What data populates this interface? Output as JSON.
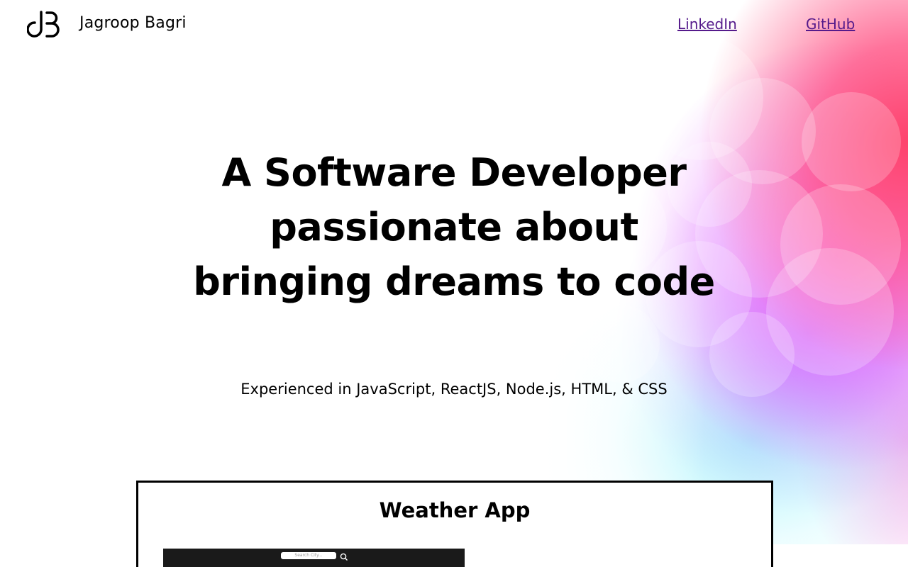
{
  "header": {
    "brand_name": "Jagroop Bagri",
    "logo_icon": "jb-monogram-icon",
    "nav": {
      "linkedin_label": "LinkedIn",
      "github_label": "GitHub",
      "link_color": "#551a8b"
    }
  },
  "hero": {
    "title_lines": [
      "A Software Developer",
      "passionate about",
      "bringing dreams to code"
    ],
    "subtitle": "Experienced in JavaScript, ReactJS, Node.js, HTML, & CSS"
  },
  "projects": [
    {
      "title": "Weather App",
      "preview": {
        "search_placeholder": "Search City...",
        "search_icon": "magnifier-icon"
      }
    }
  ],
  "colors": {
    "background": "#ffffff",
    "text": "#000000",
    "gradient_pink": "#ff3c64",
    "gradient_magenta": "#ff50e6",
    "gradient_violet": "#aa6eff",
    "gradient_cyan": "#96f0fa"
  }
}
